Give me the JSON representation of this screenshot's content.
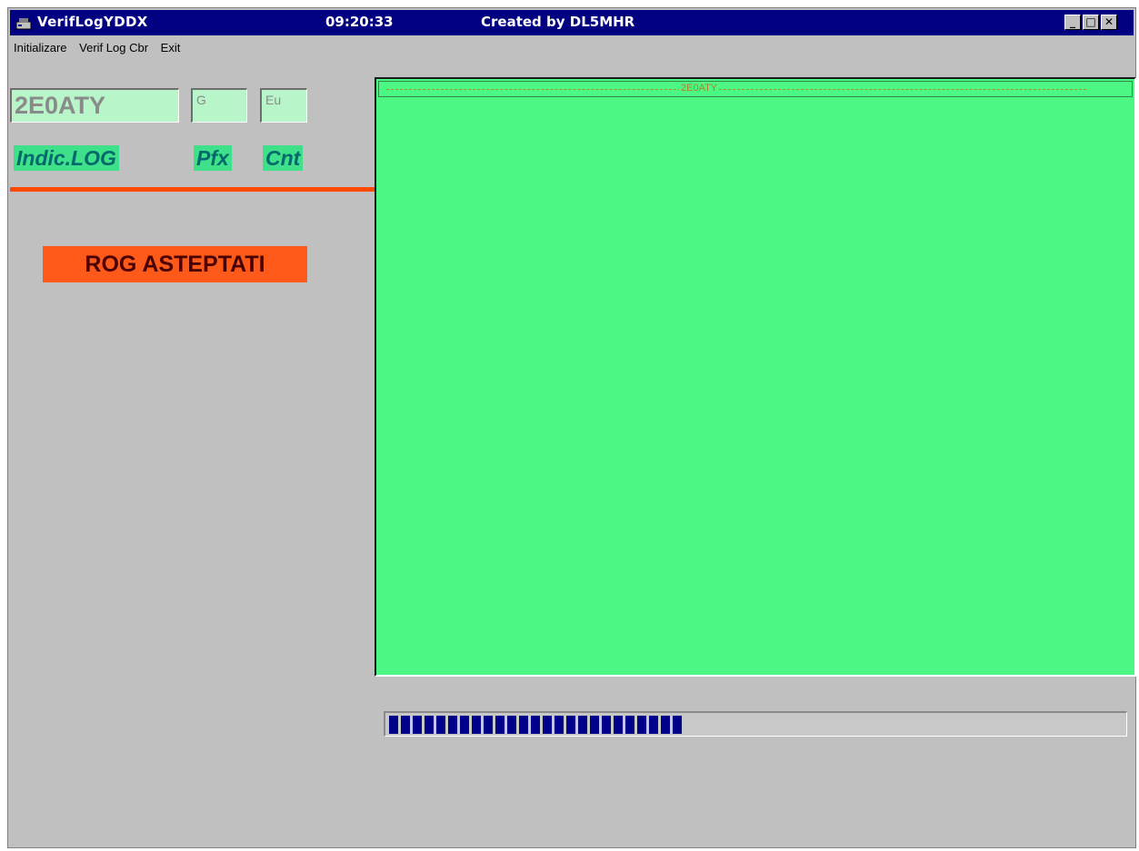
{
  "window": {
    "title": "VerifLogYDDX",
    "clock": "09:20:33",
    "credit": "Created by DL5MHR",
    "controls": {
      "minimize": "_",
      "maximize": "□",
      "close": "✕"
    }
  },
  "menu": {
    "items": [
      "Initializare",
      "Verif Log Cbr",
      "Exit"
    ]
  },
  "left_panel": {
    "callsign_value": "2E0ATY",
    "prefix_value": "G",
    "continent_value": "Eu",
    "label_indic": "Indic.LOG",
    "label_pfx": "Pfx",
    "label_cnt": "Cnt",
    "status_button": "ROG ASTEPTATI"
  },
  "log_panel": {
    "rows": [
      "2E0ATY"
    ]
  },
  "progress": {
    "fraction": 0.4
  },
  "colors": {
    "titlebar": "#000080",
    "window_bg": "#c0c0c0",
    "log_bg": "#4cf784",
    "status_bg": "#ff5a1a",
    "progress_fill": "#00008a"
  }
}
